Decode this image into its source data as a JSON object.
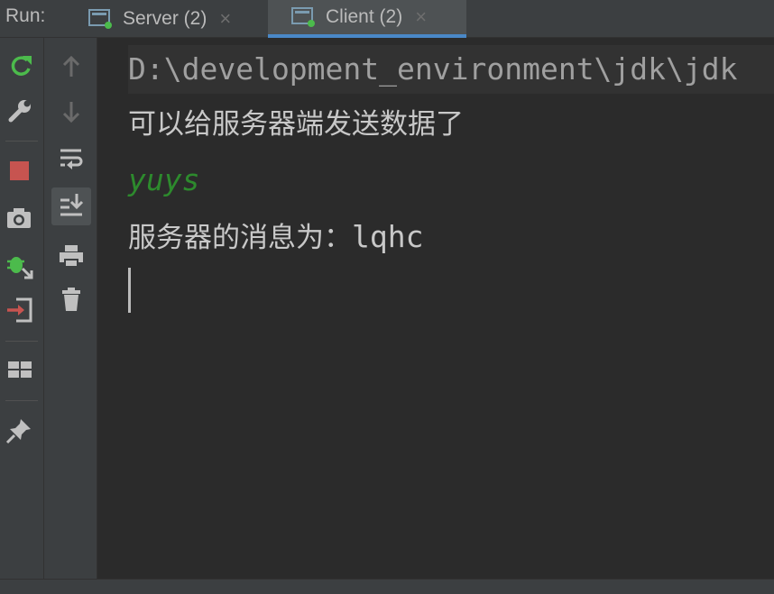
{
  "toolwindow": {
    "run_label": "Run:"
  },
  "tabs": [
    {
      "label": "Server (2)",
      "close": "×",
      "active": false
    },
    {
      "label": "Client (2)",
      "close": "×",
      "active": true
    }
  ],
  "console": {
    "command_line": "D:\\development_environment\\jdk\\jdk",
    "lines": [
      "可以给服务器端发送数据了",
      "yuys",
      "服务器的消息为：",
      "lqhc"
    ]
  },
  "colors": {
    "accent": "#4a88c7",
    "user_input": "#2d8a2d",
    "stop": "#c75450",
    "rerun": "#4cbb4c"
  },
  "icons": {
    "rerun": "rerun-icon",
    "settings": "wrench-icon",
    "stop": "stop-icon",
    "snapshot": "camera-icon",
    "debug": "debug-icon",
    "exit": "exit-icon",
    "layout": "layout-icon",
    "pin": "pin-icon",
    "up": "arrow-up-icon",
    "down": "arrow-down-icon",
    "wrap": "soft-wrap-icon",
    "scroll_end": "scroll-to-end-icon",
    "print": "print-icon",
    "trash": "trash-icon"
  }
}
